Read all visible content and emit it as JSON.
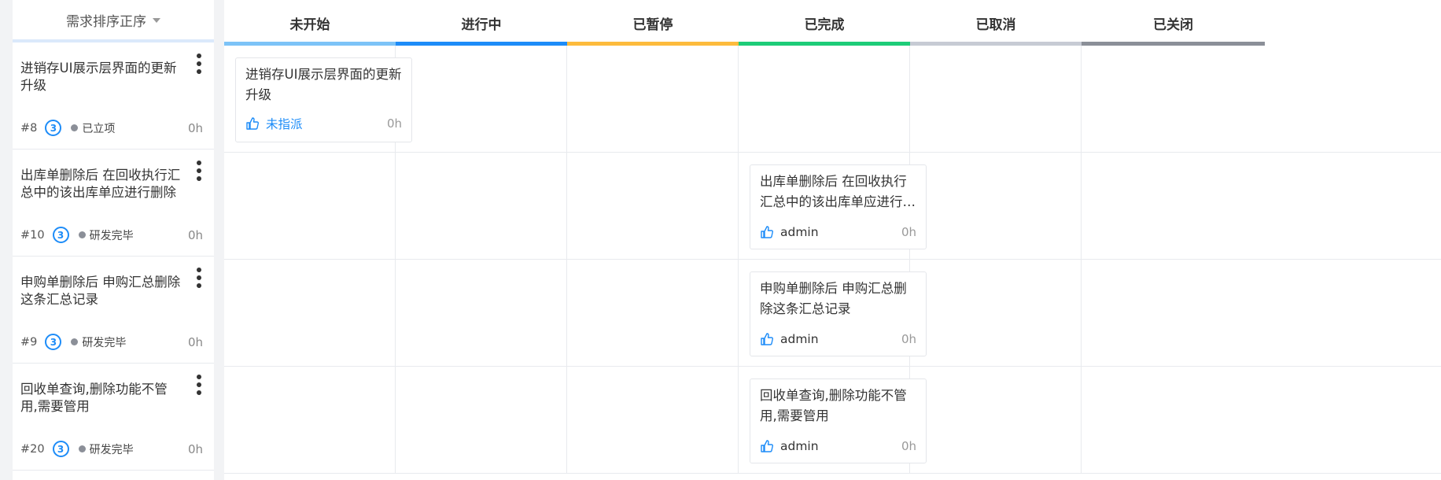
{
  "sort": {
    "label": "需求排序正序"
  },
  "columns": [
    {
      "label": "未开始",
      "color": "#7cc3f7"
    },
    {
      "label": "进行中",
      "color": "#1d8cf8"
    },
    {
      "label": "已暂停",
      "color": "#fdbb3c"
    },
    {
      "label": "已完成",
      "color": "#1dcc78"
    },
    {
      "label": "已取消",
      "color": "#c7cbd4"
    },
    {
      "label": "已关闭",
      "color": "#8b8f98"
    }
  ],
  "requirements": [
    {
      "title": "进销存UI展示层界面的更新升级",
      "id": "#8",
      "badge": "3",
      "status": "已立项",
      "hours": "0h"
    },
    {
      "title": "出库单删除后 在回收执行汇总中的该出库单应进行删除",
      "id": "#10",
      "badge": "3",
      "status": "研发完毕",
      "hours": "0h"
    },
    {
      "title": "申购单删除后 申购汇总删除这条汇总记录",
      "id": "#9",
      "badge": "3",
      "status": "研发完毕",
      "hours": "0h"
    },
    {
      "title": "回收单查询,删除功能不管用,需要管用",
      "id": "#20",
      "badge": "3",
      "status": "研发完毕",
      "hours": "0h"
    }
  ],
  "cards": [
    {
      "lane": 0,
      "column": 0,
      "title": "进销存UI展示层界面的更新升级",
      "assignee": "未指派",
      "unassigned": true,
      "hours": "0h"
    },
    {
      "lane": 1,
      "column": 3,
      "title": "出库单删除后 在回收执行汇总中的该出库单应进行删除",
      "assignee": "admin",
      "unassigned": false,
      "hours": "0h"
    },
    {
      "lane": 2,
      "column": 3,
      "title": "申购单删除后 申购汇总删除这条汇总记录",
      "assignee": "admin",
      "unassigned": false,
      "hours": "0h"
    },
    {
      "lane": 3,
      "column": 3,
      "title": "回收单查询,删除功能不管用,需要管用",
      "assignee": "admin",
      "unassigned": false,
      "hours": "0h"
    }
  ],
  "icons": {
    "assignee": "thumbs-up-icon",
    "more": "more-vertical-icon",
    "sort": "caret-down-icon"
  }
}
